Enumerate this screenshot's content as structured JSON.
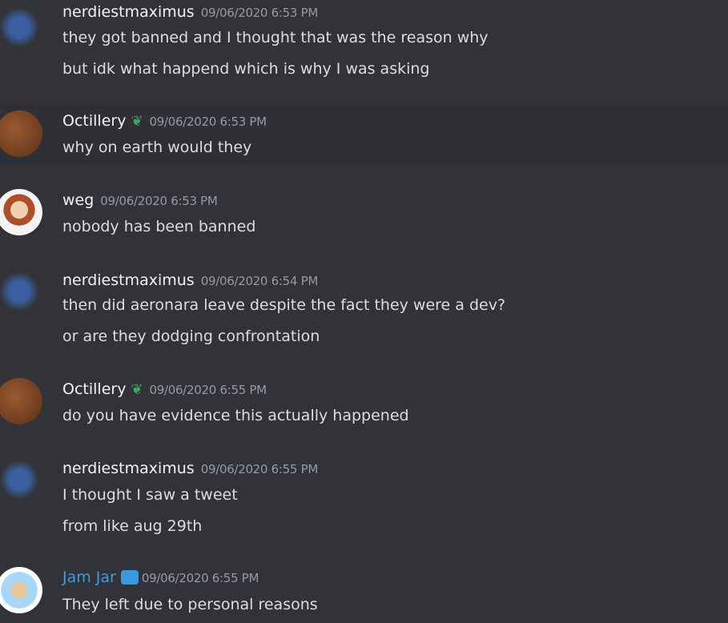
{
  "messages": [
    {
      "author": "nerdiestmaximus",
      "timestamp": "09/06/2020 6:53 PM",
      "lines": [
        "they got banned and I thought that was the reason why",
        "but idk what happend which is why I was asking"
      ]
    },
    {
      "author": "Octillery",
      "badge": "sprout-icon",
      "timestamp": "09/06/2020 6:53 PM",
      "lines": [
        "why on earth would they"
      ]
    },
    {
      "author": "weg",
      "timestamp": "09/06/2020 6:53 PM",
      "lines": [
        "nobody has been banned"
      ]
    },
    {
      "author": "nerdiestmaximus",
      "timestamp": "09/06/2020 6:54 PM",
      "lines": [
        "then did aeronara leave despite the fact they were a dev?",
        "or are they dodging confrontation"
      ]
    },
    {
      "author": "Octillery",
      "badge": "sprout-icon",
      "timestamp": "09/06/2020 6:55 PM",
      "lines": [
        "do you have evidence this actually happened"
      ]
    },
    {
      "author": "nerdiestmaximus",
      "timestamp": "09/06/2020 6:55 PM",
      "lines": [
        "I thought I saw a tweet",
        "from like aug 29th"
      ]
    },
    {
      "author": "Jam Jar",
      "badge": "cube-icon",
      "author_color": "#3aa0e0",
      "timestamp": "09/06/2020 6:55 PM",
      "lines": [
        "They left due to personal reasons"
      ]
    }
  ]
}
